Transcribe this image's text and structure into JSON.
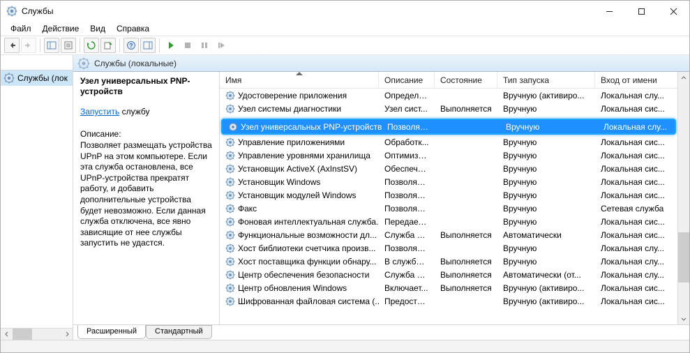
{
  "window": {
    "title": "Службы"
  },
  "menubar": {
    "file": "Файл",
    "action": "Действие",
    "view": "Вид",
    "help": "Справка"
  },
  "tree": {
    "root": "Службы (лок"
  },
  "pane_header": "Службы (локальные)",
  "detail": {
    "title": "Узел универсальных PNP-устройств",
    "start_link": "Запустить",
    "start_suffix": " службу",
    "desc_label": "Описание:",
    "description": "Позволяет размещать устройства UPnP на этом компьютере. Если эта служба остановлена, все UPnP-устройства прекратят работу, и добавить дополнительные устройства будет невозможно. Если данная служба отключена, все явно зависящие от нее службы запустить не удастся."
  },
  "columns": {
    "name": "Имя",
    "desc": "Описание",
    "state": "Состояние",
    "startup": "Тип запуска",
    "logon": "Вход от имени"
  },
  "rows": [
    {
      "name": "Удостоверение приложения",
      "desc": "Определя...",
      "state": "",
      "startup": "Вручную (активиро...",
      "logon": "Локальная слу..."
    },
    {
      "name": "Узел системы диагностики",
      "desc": "Узел сист...",
      "state": "Выполняется",
      "startup": "Вручную",
      "logon": "Локальная сис..."
    },
    {
      "name": "",
      "desc": "",
      "state": "",
      "startup": "",
      "logon": "",
      "hidden": true
    },
    {
      "name": "Узел универсальных PNP-устройств",
      "desc": "Позволяет...",
      "state": "",
      "startup": "Вручную",
      "logon": "Локальная слу...",
      "selected": true
    },
    {
      "name": "Управление приложениями",
      "desc": "Обработк...",
      "state": "",
      "startup": "Вручную",
      "logon": "Локальная сис..."
    },
    {
      "name": "Управление уровнями хранилища",
      "desc": "Оптимизи...",
      "state": "",
      "startup": "Вручную",
      "logon": "Локальная сис..."
    },
    {
      "name": "Установщик ActiveX (AxInstSV)",
      "desc": "Обеспечи...",
      "state": "",
      "startup": "Вручную",
      "logon": "Локальная сис..."
    },
    {
      "name": "Установщик Windows",
      "desc": "Позволяет...",
      "state": "",
      "startup": "Вручную",
      "logon": "Локальная сис..."
    },
    {
      "name": "Установщик модулей Windows",
      "desc": "Позволяет...",
      "state": "",
      "startup": "Вручную",
      "logon": "Локальная сис..."
    },
    {
      "name": "Факс",
      "desc": "Позволяет...",
      "state": "",
      "startup": "Вручную",
      "logon": "Сетевая служба"
    },
    {
      "name": "Фоновая интеллектуальная служба...",
      "desc": "Передает ...",
      "state": "",
      "startup": "Вручную",
      "logon": "Локальная сис..."
    },
    {
      "name": "Функциональные возможности дл...",
      "desc": "Служба ф...",
      "state": "Выполняется",
      "startup": "Автоматически",
      "logon": "Локальная сис..."
    },
    {
      "name": "Хост библиотеки счетчика произв...",
      "desc": "Позволяет...",
      "state": "",
      "startup": "Вручную",
      "logon": "Локальная слу..."
    },
    {
      "name": "Хост поставщика функции обнару...",
      "desc": "В службе ...",
      "state": "Выполняется",
      "startup": "Вручную",
      "logon": "Локальная слу..."
    },
    {
      "name": "Центр обеспечения безопасности",
      "desc": "Служба W...",
      "state": "Выполняется",
      "startup": "Автоматически (от...",
      "logon": "Локальная слу..."
    },
    {
      "name": "Центр обновления Windows",
      "desc": "Включает...",
      "state": "Выполняется",
      "startup": "Вручную (активиро...",
      "logon": "Локальная сис..."
    },
    {
      "name": "Шифрованная файловая система (...",
      "desc": "Предостав...",
      "state": "",
      "startup": "Вручную (активиро...",
      "logon": "Локальная сис..."
    }
  ],
  "tabs": {
    "extended": "Расширенный",
    "standard": "Стандартный"
  }
}
